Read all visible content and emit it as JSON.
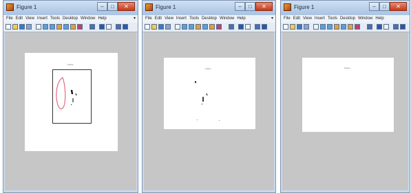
{
  "windows": [
    {
      "title": "Figure 1",
      "figure_title": "Frame",
      "figure_subtitle": "·· ··",
      "menus": [
        "File",
        "Edit",
        "View",
        "Insert",
        "Tools",
        "Desktop",
        "Window",
        "Help"
      ],
      "menu_arrow": "▾",
      "controls": {
        "minimize": "–",
        "maximize": "□",
        "close": "✕"
      }
    },
    {
      "title": "Figure 1",
      "figure_title": "Frame",
      "figure_subtitle": "·· ··",
      "menus": [
        "File",
        "Edit",
        "View",
        "Insert",
        "Tools",
        "Desktop",
        "Window",
        "Help"
      ],
      "menu_arrow": "▾",
      "controls": {
        "minimize": "–",
        "maximize": "□",
        "close": "✕"
      }
    },
    {
      "title": "Figure 1",
      "figure_title": "Frame",
      "figure_subtitle": "·· ··",
      "menus": [
        "File",
        "Edit",
        "View",
        "Insert",
        "Tools",
        "Desktop",
        "Window",
        "Help"
      ],
      "menu_arrow": "",
      "controls": {
        "minimize": "–",
        "maximize": "□",
        "close": "✕"
      }
    }
  ],
  "toolbar_icons": [
    "new-figure-icon",
    "open-file-icon",
    "save-icon",
    "print-icon",
    "pointer-icon",
    "zoom-in-icon",
    "zoom-out-icon",
    "pan-icon",
    "rotate-icon",
    "data-cursor-icon",
    "brush-icon",
    "link-icon",
    "colorbar-icon",
    "legend-icon",
    "hide-tools-icon",
    "show-tools-icon"
  ],
  "colors": {
    "titlebar": "#b7cde8",
    "close_button": "#c9442a",
    "figure_background": "#c6c6c6",
    "sketch_red": "#e06a80",
    "sketch_black": "#000000"
  }
}
